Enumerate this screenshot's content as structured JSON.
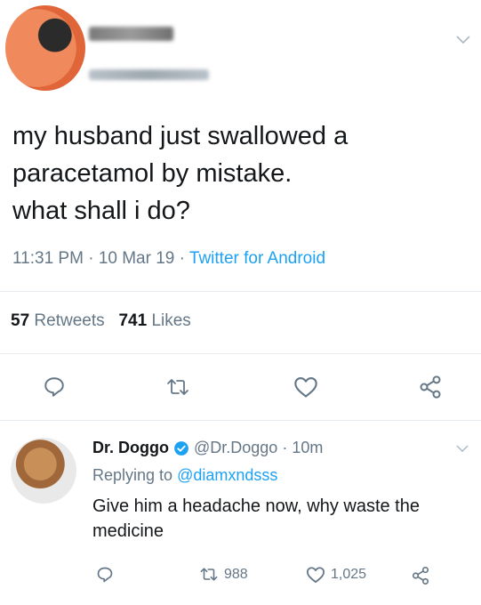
{
  "tweet": {
    "text_lines": [
      "my husband just swallowed a",
      "paracetamol by mistake.",
      "what shall i do?"
    ],
    "time": "11:31 PM",
    "date": "10 Mar 19",
    "separator": "·",
    "client": "Twitter for Android",
    "retweets_count": "57",
    "retweets_label": "Retweets",
    "likes_count": "741",
    "likes_label": "Likes"
  },
  "reply": {
    "display_name": "Dr. Doggo",
    "handle": "@Dr.Doggo",
    "separator": "·",
    "age": "10m",
    "replying_label": "Replying to",
    "replying_handle": "@diamxndsss",
    "text": "Give him a headache now, why waste the medicine",
    "retweets": "988",
    "likes": "1,025"
  },
  "colors": {
    "accent": "#1da1f2",
    "muted": "#657786",
    "text": "#14171a",
    "divider": "#e6ecf0"
  },
  "icons": [
    "reply-icon",
    "retweet-icon",
    "like-icon",
    "share-icon",
    "chevron-down-icon",
    "verified-badge-icon"
  ]
}
